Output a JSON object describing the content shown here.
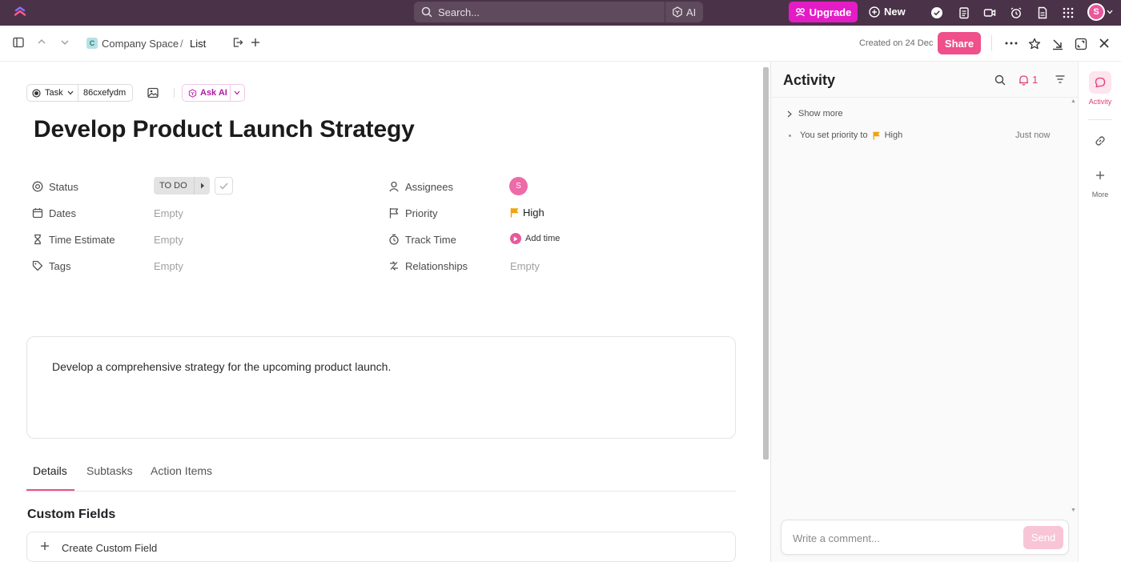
{
  "topbar": {
    "search_placeholder": "Search...",
    "ai_label": "AI",
    "upgrade_label": "Upgrade",
    "new_label": "New",
    "avatar_initial": "S"
  },
  "header": {
    "space_initial": "C",
    "breadcrumb_space": "Company Space",
    "breadcrumb_sep": "/",
    "breadcrumb_list": "List",
    "created": "Created on 24 Dec",
    "share_label": "Share"
  },
  "task": {
    "type_label": "Task",
    "task_id": "86cxefydm",
    "ask_ai_label": "Ask AI",
    "title": "Develop Product Launch Strategy",
    "description": "Develop a comprehensive strategy for the upcoming product launch."
  },
  "properties": {
    "status": {
      "label": "Status",
      "value": "TO DO"
    },
    "dates": {
      "label": "Dates",
      "value": "Empty"
    },
    "time_estimate": {
      "label": "Time Estimate",
      "value": "Empty"
    },
    "tags": {
      "label": "Tags",
      "value": "Empty"
    },
    "assignees": {
      "label": "Assignees",
      "avatar_initial": "S"
    },
    "priority": {
      "label": "Priority",
      "value": "High"
    },
    "track_time": {
      "label": "Track Time",
      "value": "Add time"
    },
    "relationships": {
      "label": "Relationships",
      "value": "Empty"
    }
  },
  "tabs": [
    {
      "label": "Details",
      "active": true
    },
    {
      "label": "Subtasks",
      "active": false
    },
    {
      "label": "Action Items",
      "active": false
    }
  ],
  "custom_fields": {
    "title": "Custom Fields",
    "create_label": "Create Custom Field"
  },
  "activity": {
    "title": "Activity",
    "notification_count": "1",
    "show_more": "Show more",
    "entries": [
      {
        "text": "You set priority to",
        "value": "High",
        "time": "Just now"
      }
    ],
    "comment_placeholder": "Write a comment...",
    "send_label": "Send"
  },
  "rail": {
    "activity_label": "Activity",
    "more_label": "More"
  },
  "colors": {
    "topbar_bg": "#4a3248",
    "accent_pink": "#ef4f8a",
    "upgrade_magenta": "#e31cc6",
    "priority_flag": "#f0a30a"
  }
}
